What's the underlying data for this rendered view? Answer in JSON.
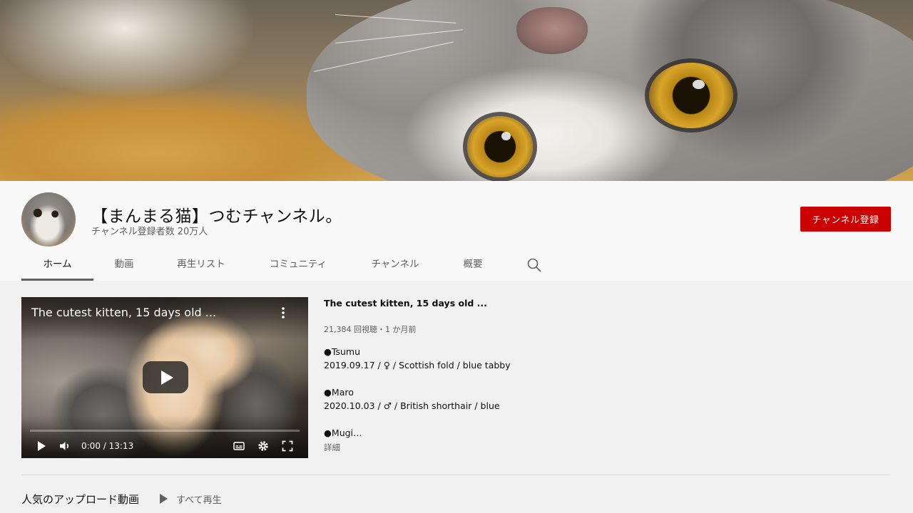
{
  "channel": {
    "name": "【まんまる猫】つむチャンネル。",
    "subscribers": "チャンネル登録者数 20万人",
    "subscribe_label": "チャンネル登録"
  },
  "tabs": [
    {
      "label": "ホーム",
      "active": true
    },
    {
      "label": "動画",
      "active": false
    },
    {
      "label": "再生リスト",
      "active": false
    },
    {
      "label": "コミュニティ",
      "active": false
    },
    {
      "label": "チャンネル",
      "active": false
    },
    {
      "label": "概要",
      "active": false
    }
  ],
  "icons": {
    "tab_search": "search-icon",
    "player_menu": "more-vert-icon",
    "play": "play-icon",
    "volume": "volume-icon",
    "subtitles": "subtitles-icon",
    "settings": "gear-icon",
    "fullscreen": "fullscreen-icon"
  },
  "featured_video": {
    "player_title": "The cutest kitten, 15 days old ...",
    "time": "0:00 / 13:13",
    "progress": 0,
    "title": "The cutest kitten, 15 days old ...",
    "meta": "21,384 回視聴・1 か月前",
    "description": [
      "●Tsumu",
      "2019.09.17 / ♀ / Scottish fold / blue tabby",
      "●Maro",
      "2020.10.03 / ♂ / British shorthair / blue",
      "●Mugi…"
    ],
    "more_label": "詳細"
  },
  "shelf": {
    "title": "人気のアップロード動画",
    "play_all_label": "すべて再生"
  },
  "colors": {
    "subscribe": "#cc0000",
    "page_background": "#f1f1f1",
    "header_background": "#f9f9f9",
    "secondary_text": "#606060"
  }
}
